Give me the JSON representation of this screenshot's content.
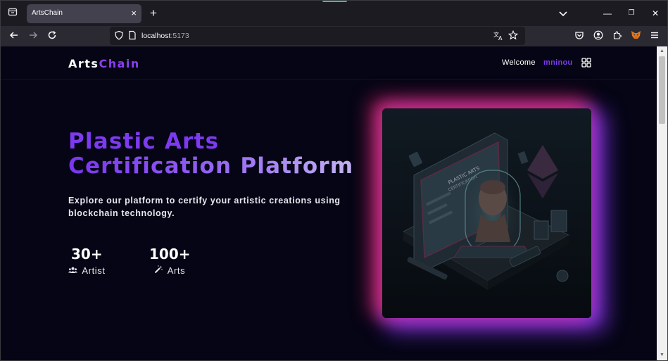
{
  "browser": {
    "tab": {
      "title": "ArtsChain",
      "close_icon": "×"
    },
    "new_tab_icon": "+",
    "url": {
      "host": "localhost",
      "port": ":5173"
    },
    "window_controls": {
      "minimize": "—",
      "restore": "❐",
      "close": "✕"
    },
    "icons": {
      "tab_list": "tab-list-icon",
      "back": "arrow-left-icon",
      "forward": "arrow-right-icon",
      "reload": "reload-icon",
      "shield": "shield-icon",
      "page_info": "page-icon",
      "translate": "translate-icon",
      "bookmark": "star-icon",
      "pocket": "pocket-icon",
      "account": "account-icon",
      "extensions": "puzzle-icon",
      "metamask": "fox-icon",
      "menu": "hamburger-icon"
    }
  },
  "site": {
    "logo": {
      "part1": "Arts",
      "part2": "Chain"
    },
    "header": {
      "welcome": "Welcome",
      "username": "mninou"
    },
    "hero": {
      "title_line1": "Plastic Arts",
      "title_line2": "Certification Platform",
      "description": "Explore our platform to certify your artistic creations using blockchain technology."
    },
    "stats": [
      {
        "value": "30+",
        "label": "Artist",
        "icon": "users-icon"
      },
      {
        "value": "100+",
        "label": "Arts",
        "icon": "magic-wand-icon"
      }
    ],
    "colors": {
      "accent": "#7c3aed",
      "background": "#050515",
      "glow_pink": "#ec2b6e",
      "glow_purple": "#8638f6"
    }
  }
}
